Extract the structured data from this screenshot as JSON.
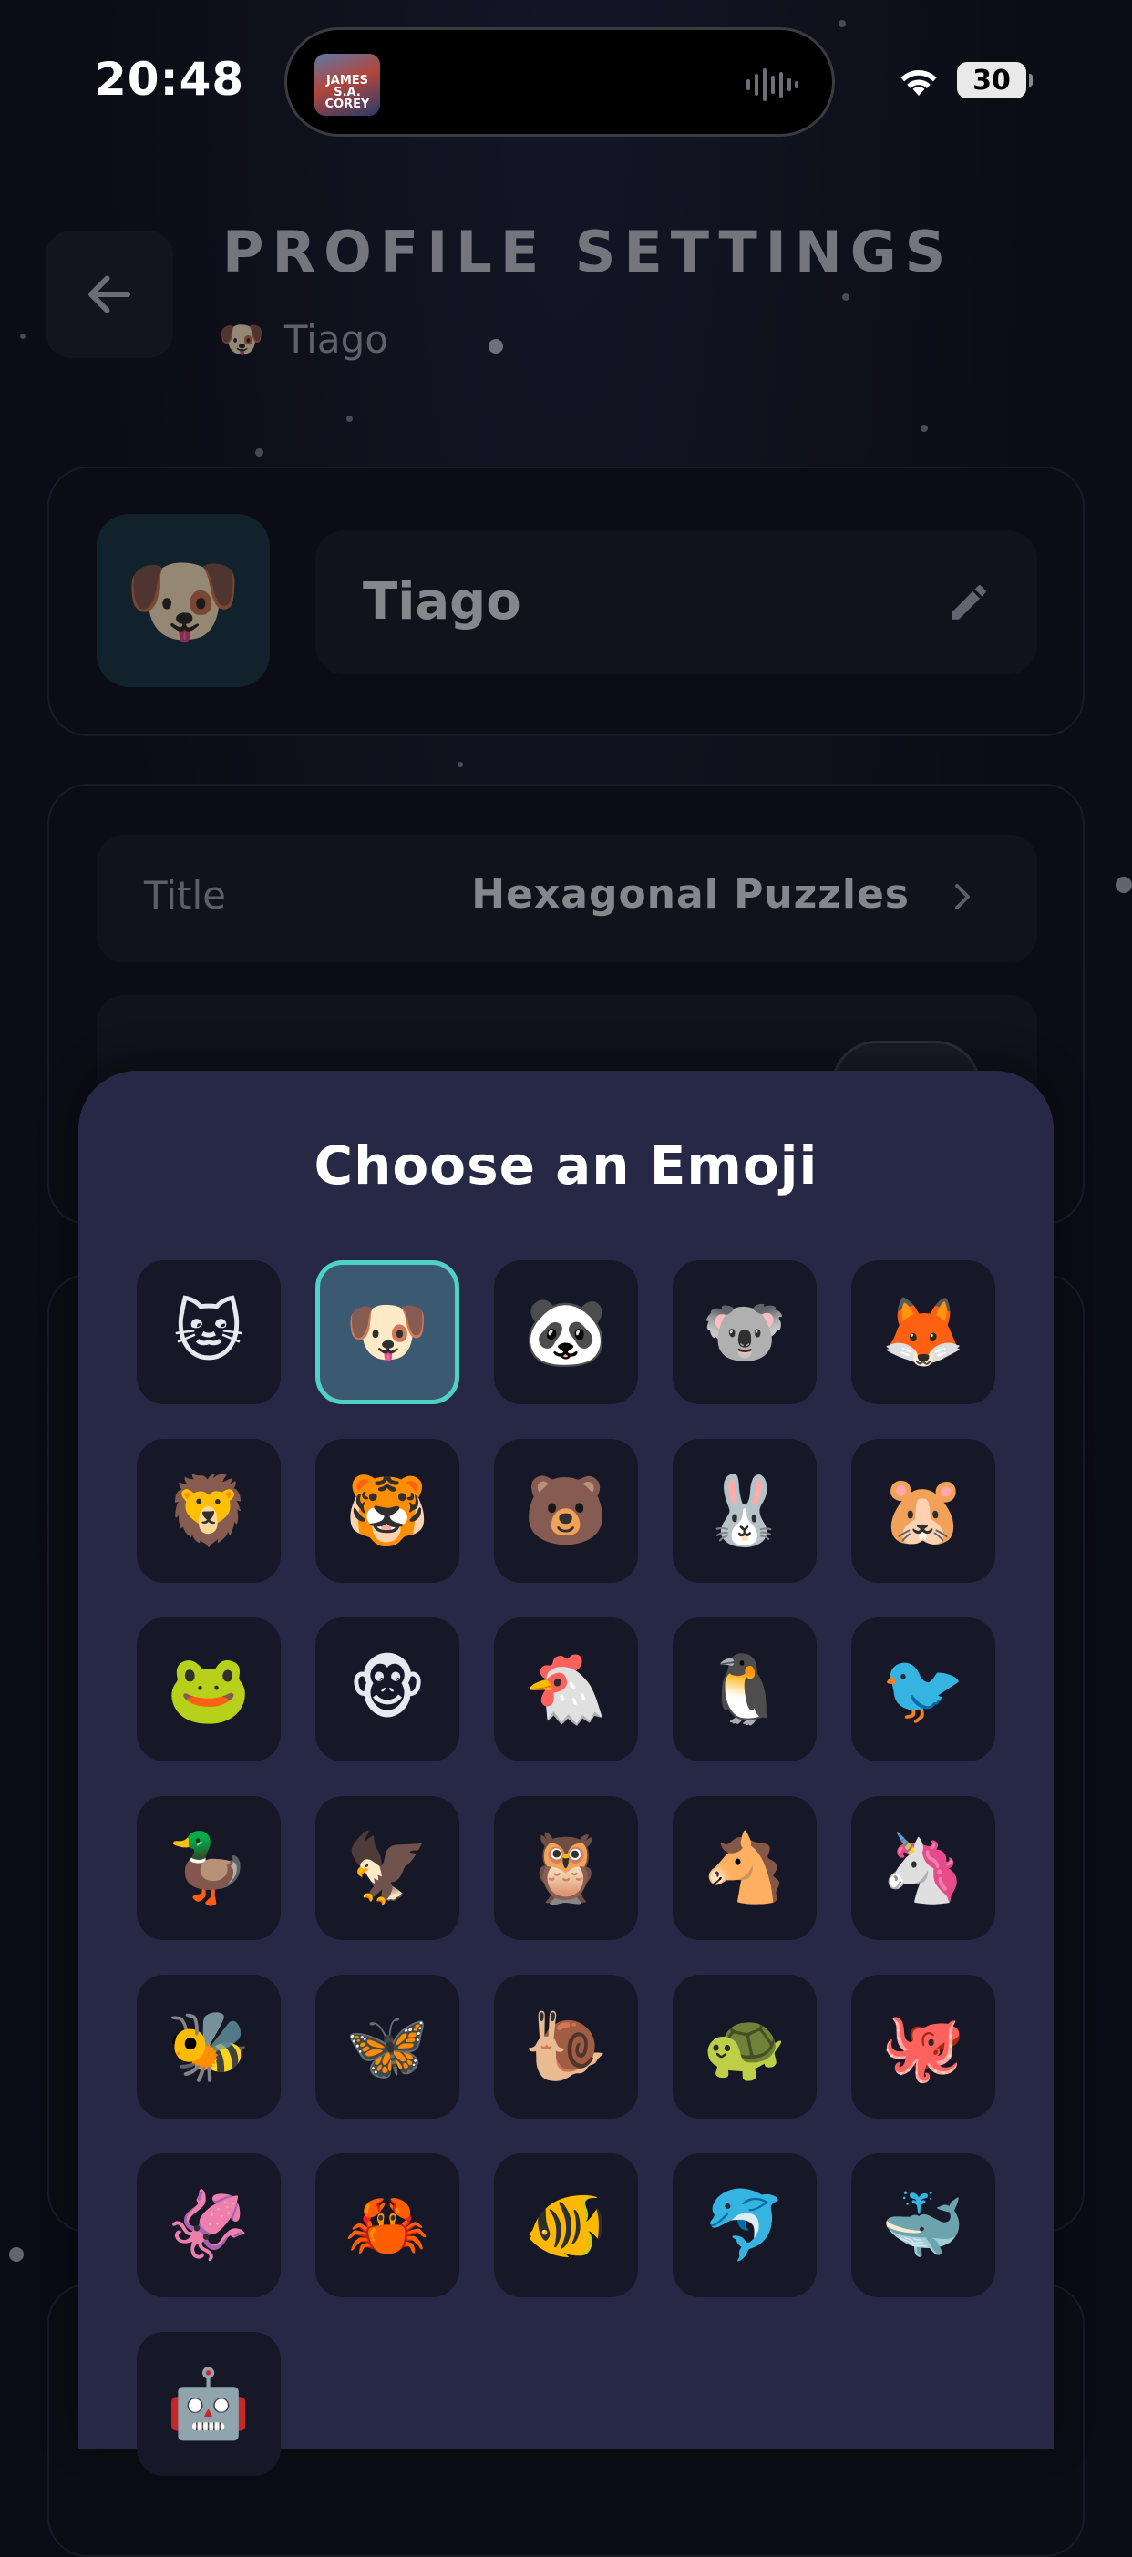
{
  "status_bar": {
    "time": "20:48",
    "battery": "30",
    "now_playing_art_text": "JAMES S.A. COREY"
  },
  "header": {
    "title": "PROFILE SETTINGS",
    "subtitle_emoji": "🐶",
    "subtitle_name": "Tiago"
  },
  "profile_card": {
    "avatar_emoji": "🐶",
    "name": "Tiago"
  },
  "settings_card": {
    "title_label": "Title",
    "title_value": "Hexagonal Puzzles"
  },
  "emoji_picker": {
    "title": "Choose an Emoji",
    "selected_index": 1,
    "emojis": [
      "🐱",
      "🐶",
      "🐼",
      "🐨",
      "🦊",
      "🦁",
      "🐯",
      "🐻",
      "🐰",
      "🐹",
      "🐸",
      "🐵",
      "🐔",
      "🐧",
      "🐦",
      "🦆",
      "🦅",
      "🦉",
      "🐴",
      "🦄",
      "🐝",
      "🦋",
      "🐌",
      "🐢",
      "🐙",
      "🦑",
      "🦀",
      "🐠",
      "🐬",
      "🐳",
      "🤖"
    ]
  },
  "colors": {
    "background": "#0b0c15",
    "card": "#141623",
    "modal": "#272845",
    "tile": "#171827",
    "selected_border": "#4fd1c8"
  }
}
